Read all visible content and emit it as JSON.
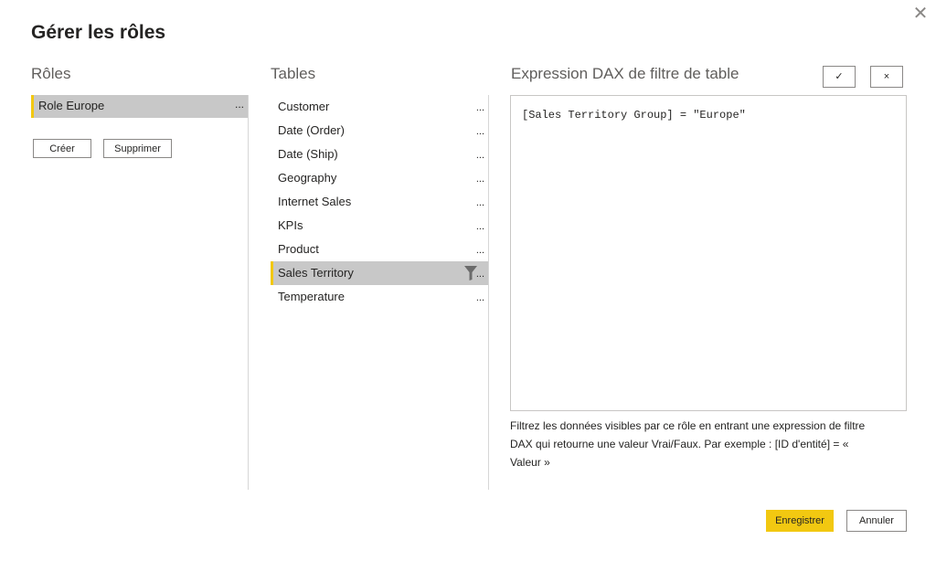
{
  "dialog": {
    "title": "Gérer les rôles",
    "close_icon": "close-icon"
  },
  "roles": {
    "header": "Rôles",
    "items": [
      {
        "label": "Role Europe",
        "selected": true,
        "more": "..."
      }
    ],
    "create_label": "Créer",
    "delete_label": "Supprimer"
  },
  "tables": {
    "header": "Tables",
    "items": [
      {
        "label": "Customer",
        "more": "...",
        "selected": false,
        "filtered": false
      },
      {
        "label": "Date (Order)",
        "more": "...",
        "selected": false,
        "filtered": false
      },
      {
        "label": "Date (Ship)",
        "more": "...",
        "selected": false,
        "filtered": false
      },
      {
        "label": "Geography",
        "more": "...",
        "selected": false,
        "filtered": false
      },
      {
        "label": "Internet Sales",
        "more": "...",
        "selected": false,
        "filtered": false
      },
      {
        "label": "KPIs",
        "more": "...",
        "selected": false,
        "filtered": false
      },
      {
        "label": "Product",
        "more": "...",
        "selected": false,
        "filtered": false
      },
      {
        "label": "Sales Territory",
        "more": "...",
        "selected": true,
        "filtered": true
      },
      {
        "label": "Temperature",
        "more": "...",
        "selected": false,
        "filtered": false
      }
    ]
  },
  "dax": {
    "header": "Expression DAX de filtre de table",
    "expression": "[Sales Territory Group] = \"Europe\"",
    "confirm_symbol": "✓",
    "cancel_symbol": "×",
    "help_text": "Filtrez les données visibles par ce rôle en entrant une expression de filtre DAX qui retourne une valeur Vrai/Faux. Par exemple : [ID d'entité] = « Valeur »"
  },
  "footer": {
    "save_label": "Enregistrer",
    "cancel_label": "Annuler"
  },
  "colors": {
    "accent": "#f2c811",
    "selected_bg": "#c8c8c8"
  }
}
